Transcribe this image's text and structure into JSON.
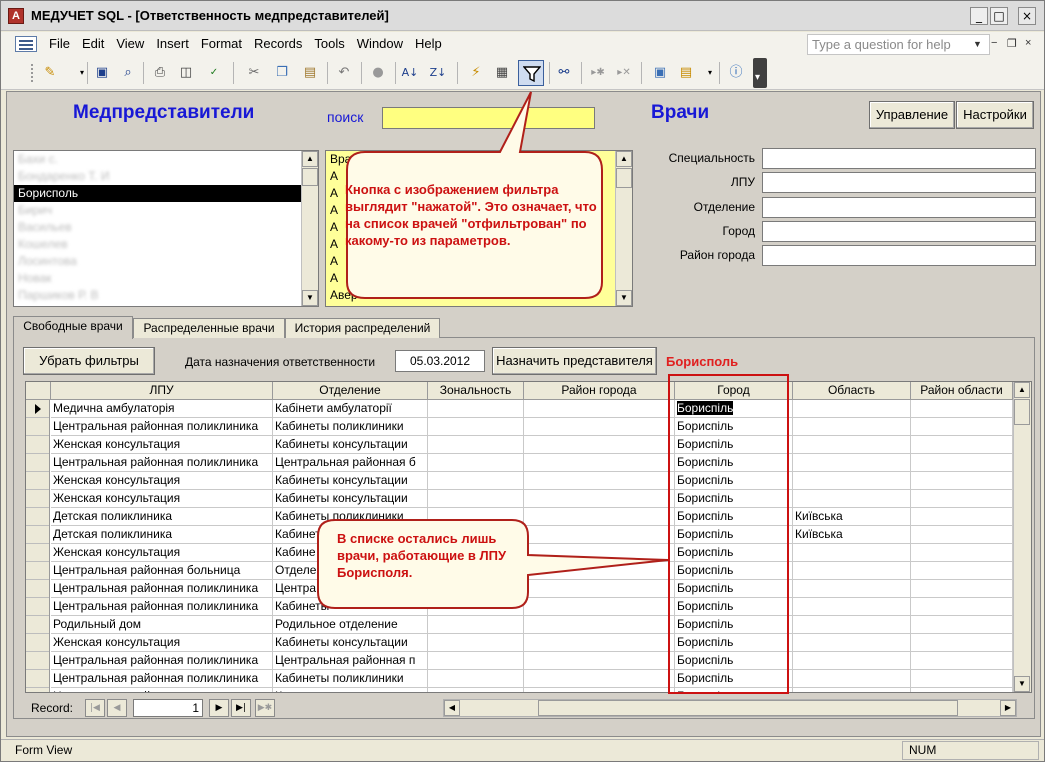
{
  "window": {
    "title": "МЕДУЧЕТ SQL - [Ответственность медпредставителей]",
    "min_glyph": "_",
    "max_glyph": "□",
    "close_glyph": "×"
  },
  "menu": {
    "items": [
      "File",
      "Edit",
      "View",
      "Insert",
      "Format",
      "Records",
      "Tools",
      "Window",
      "Help"
    ],
    "help_placeholder": "Type a question for help"
  },
  "form": {
    "heading_reps": "Медпредставители",
    "search_label": "поиск",
    "search_value": "",
    "heading_doctors": "Врачи",
    "btn_manage": "Управление",
    "btn_settings": "Настройки",
    "reps_list": [
      {
        "text": "Бахи с.",
        "blurred": true,
        "selected": false
      },
      {
        "text": "Бондаренко Т. И",
        "blurred": true,
        "selected": false
      },
      {
        "text": "Борисполь",
        "blurred": false,
        "selected": true
      },
      {
        "text": "Бирич",
        "blurred": true,
        "selected": false
      },
      {
        "text": "Васильев",
        "blurred": true,
        "selected": false
      },
      {
        "text": "Кошелев",
        "blurred": true,
        "selected": false
      },
      {
        "text": "Лосинтова",
        "blurred": true,
        "selected": false
      },
      {
        "text": "Новак",
        "blurred": true,
        "selected": false
      },
      {
        "text": "Паршиков Р. В",
        "blurred": true,
        "selected": false
      }
    ],
    "doctors_list": [
      "Врач",
      "А",
      "А",
      "А",
      "А",
      "А",
      "А",
      "А",
      "Авер"
    ],
    "fields": {
      "specialty": "Специальность",
      "lpu": "ЛПУ",
      "department": "Отделение",
      "city": "Город",
      "district": "Район города"
    },
    "tabs": [
      "Свободные врачи",
      "Распределенные врачи",
      "История распределений"
    ],
    "btn_clear_filters": "Убрать фильтры",
    "date_label": "Дата назначения ответственности",
    "date_value": "05.03.2012",
    "btn_assign": "Назначить представителя",
    "selected_rep": "Борисполь"
  },
  "grid": {
    "columns": [
      "ЛПУ",
      "Отделение",
      "Зональность",
      "Район города",
      "Город",
      "Область",
      "Район области"
    ],
    "rows": [
      [
        "Медична амбулаторія",
        "Кабінети амбулаторії",
        "",
        "",
        "Бориспіль",
        ""
      ],
      [
        "Центральная районная поликлиника",
        "Кабинеты поликлиники",
        "",
        "",
        "Бориспіль",
        ""
      ],
      [
        "Женская консультация",
        "Кабинеты консультации",
        "",
        "",
        "Бориспіль",
        ""
      ],
      [
        "Центральная районная поликлиника",
        "Центральная районная б",
        "",
        "",
        "Бориспіль",
        ""
      ],
      [
        "Женская консультация",
        "Кабинеты консультации",
        "",
        "",
        "Бориспіль",
        ""
      ],
      [
        "Женская консультация",
        "Кабинеты консультации",
        "",
        "",
        "Бориспіль",
        ""
      ],
      [
        "Детская поликлиника",
        "Кабинеты поликлиники",
        "",
        "",
        "Бориспіль",
        "Київська"
      ],
      [
        "Детская поликлиника",
        "Кабинет",
        "",
        "",
        "Бориспіль",
        "Київська"
      ],
      [
        "Женская консультация",
        "Кабине",
        "",
        "",
        "Бориспіль",
        ""
      ],
      [
        "Центральная районная больница",
        "Отделе",
        "",
        "",
        "Бориспіль",
        ""
      ],
      [
        "Центральная районная поликлиника",
        "Центра",
        "",
        "",
        "Бориспіль",
        ""
      ],
      [
        "Центральная районная поликлиника",
        "Кабинеты",
        "",
        "",
        "Бориспіль",
        ""
      ],
      [
        "Родильный дом",
        "Родильное отделение",
        "",
        "",
        "Бориспіль",
        ""
      ],
      [
        "Женская консультация",
        "Кабинеты консультации",
        "",
        "",
        "Бориспіль",
        ""
      ],
      [
        "Центральная районная поликлиника",
        "Центральная районная п",
        "",
        "",
        "Бориспіль",
        ""
      ],
      [
        "Центральная районная поликлиника",
        "Кабинеты поликлиники",
        "",
        "",
        "Бориспіль",
        ""
      ],
      [
        "Центральная районная поликлиника",
        "Киевская медицинская",
        "",
        "",
        "Бориспіль",
        ""
      ]
    ]
  },
  "recnav": {
    "label": "Record:",
    "current": "1"
  },
  "status": {
    "mode": "Form View",
    "num": "NUM"
  },
  "callouts": {
    "filter_note": "Кнопка с изображением фильтра выглядит \"нажатой\". Это означает, что на список врачей \"отфильтрован\" по какому-то из параметров.",
    "list_note": "В списке остались лишь врачи, работающие в ЛПУ Борисполя."
  },
  "colors": {
    "heading_blue": "#1818d6",
    "search_yellow": "#ffff80",
    "accent_red": "#cc1111"
  }
}
